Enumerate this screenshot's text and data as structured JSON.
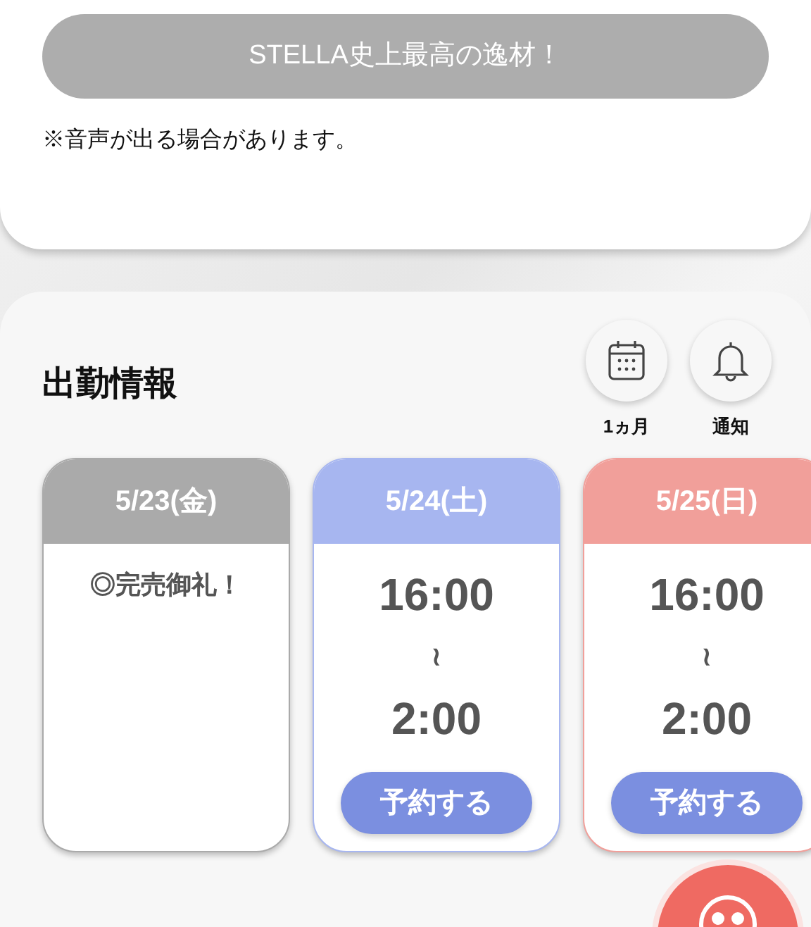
{
  "banner": {
    "text": "STELLA史上最高の逸材！"
  },
  "notice": "※音声が出る場合があります。",
  "schedule": {
    "title": "出勤情報",
    "actions": [
      {
        "kind": "calendar",
        "label": "1ヵ月"
      },
      {
        "kind": "bell",
        "label": "通知"
      }
    ],
    "days": [
      {
        "kind": "closed",
        "date": "5/23(金)",
        "color": "#aaaaaa",
        "note": "◎完売御礼！"
      },
      {
        "kind": "shift",
        "date": "5/24(土)",
        "color": "#a7b6f0",
        "start": "16:00",
        "separator": "≀",
        "end": "2:00",
        "button": "予約する"
      },
      {
        "kind": "shift",
        "date": "5/25(日)",
        "color": "#f19f9a",
        "start": "16:00",
        "separator": "≀",
        "end": "2:00",
        "button": "予約する"
      }
    ]
  }
}
